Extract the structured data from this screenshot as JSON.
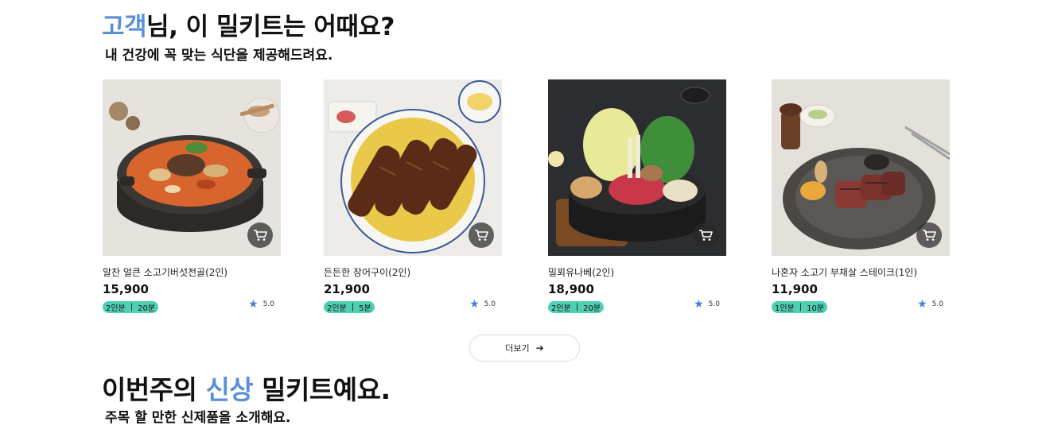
{
  "recommend": {
    "title_accent": "고객",
    "title_rest": "님, 이 밀키트는 어때요?",
    "subtitle": "내 건강에 꼭 맞는 식단을 제공해드려요."
  },
  "products": [
    {
      "name": "알찬 얼큰 소고기버섯전골(2인)",
      "price": "15,900",
      "servings": "2인분",
      "time": "20분",
      "rating": "5.0",
      "image_icon": "mushroom-beef-hotpot-photo"
    },
    {
      "name": "든든한 장어구이(2인)",
      "price": "21,900",
      "servings": "2인분",
      "time": "5분",
      "rating": "5.0",
      "image_icon": "grilled-eel-bowl-photo"
    },
    {
      "name": "밀푀유나베(2인)",
      "price": "18,900",
      "servings": "2인분",
      "time": "20분",
      "rating": "5.0",
      "image_icon": "millefeuille-nabe-photo"
    },
    {
      "name": "나혼자 소고기 부채살 스테이크(1인)",
      "price": "11,900",
      "servings": "1인분",
      "time": "10분",
      "rating": "5.0",
      "image_icon": "beef-steak-plate-photo"
    }
  ],
  "more_button": {
    "label": "더보기",
    "arrow": "➔"
  },
  "new_section": {
    "title_pre": "이번주의 ",
    "title_accent": "신상",
    "title_post": " 밀키트예요.",
    "subtitle": "주목 할 만한 신제품을 소개해요."
  },
  "colors": {
    "accent": "#5b8fd8",
    "badge": "#4fd0b3",
    "star": "#4b7fd6"
  },
  "separator": "|",
  "star_glyph": "★"
}
